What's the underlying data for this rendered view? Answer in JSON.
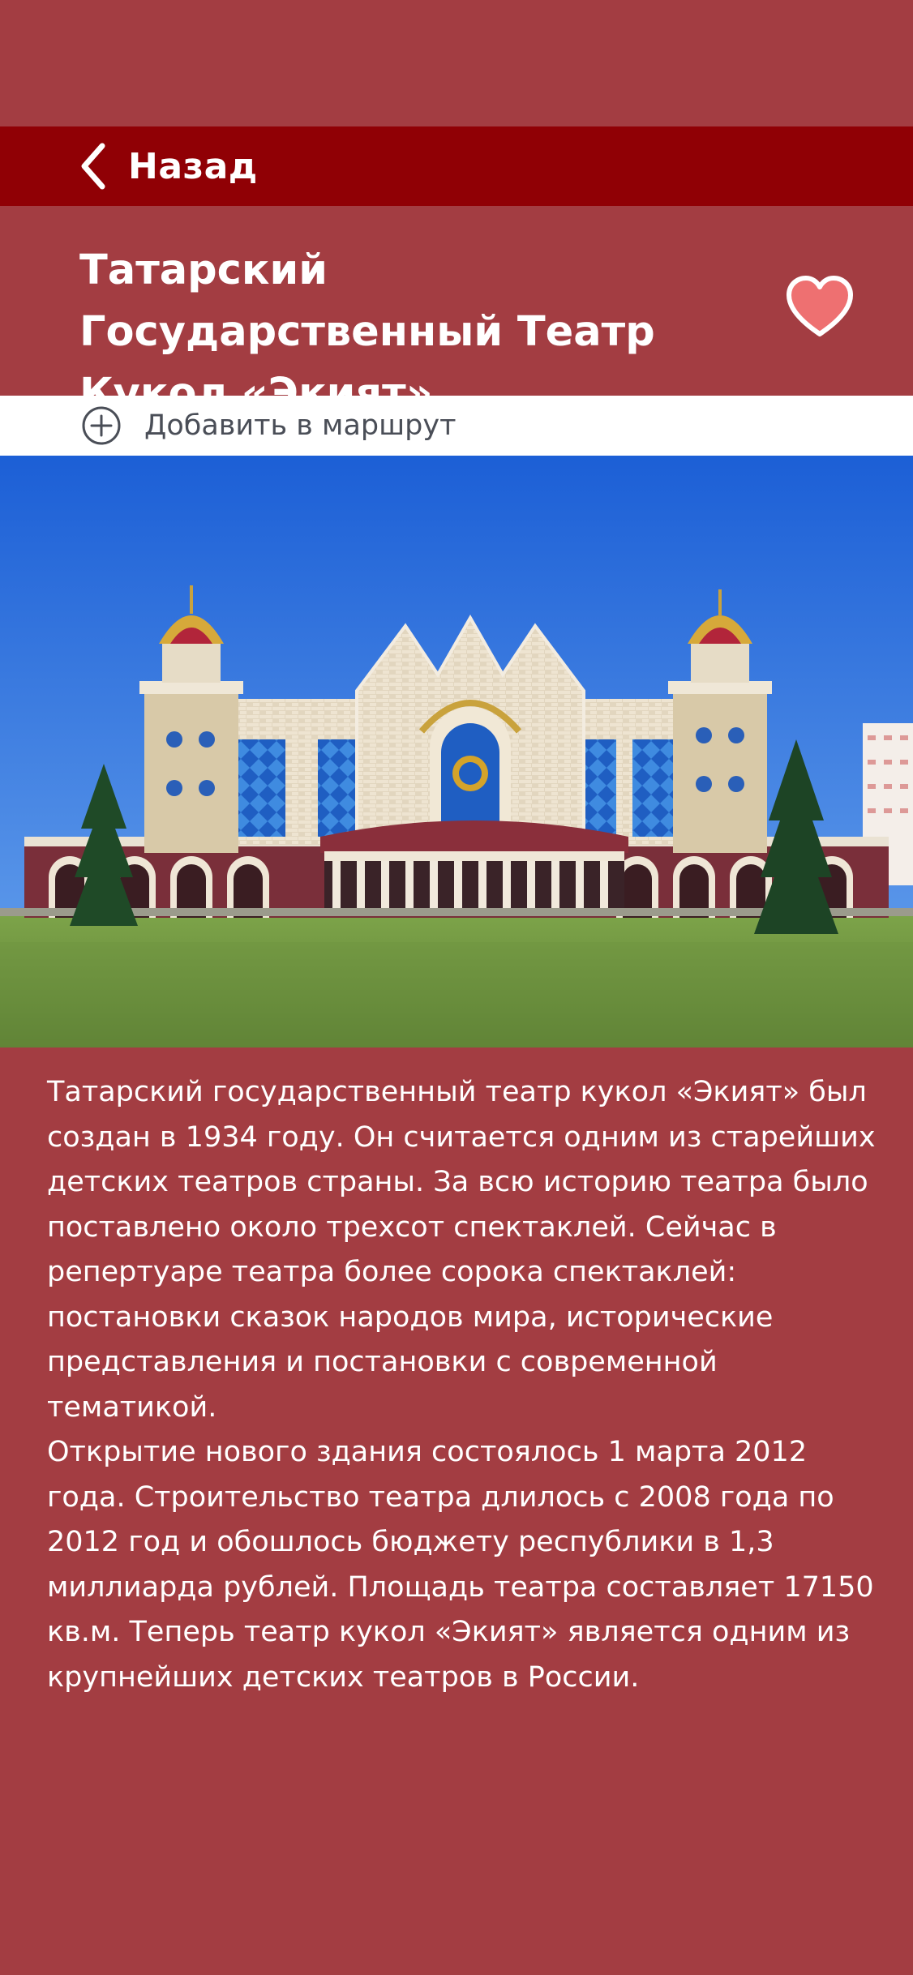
{
  "nav": {
    "back_label": "Назад"
  },
  "place": {
    "title": "Татарский Государственный Театр Кукол «Экият»",
    "favorite": true
  },
  "route": {
    "add_label": "Добавить в маршрут"
  },
  "colors": {
    "background": "#A33D42",
    "navbar": "#900005",
    "heart": "#EE7071",
    "route_text": "#4a4e57"
  },
  "description": {
    "paragraph1": "Татарский государственный театр кукол «Экият» был создан в 1934 году. Он считается одним из старейших детских театров страны. За всю историю театра было поставлено около трехсот спектаклей. Сейчас в репертуаре театра более сорока спектаклей: постановки сказок народов мира, исторические представления и постановки с современной тематикой.",
    "paragraph2": "Открытие нового здания состоялось 1 марта 2012 года. Строительство театра длилось с 2008 года по 2012 год и обошлось бюджету республики в 1,3 миллиарда рублей. Площадь театра составляет 17150 кв.м. Теперь театр кукол «Экият» является одним из крупнейших детских театров в России."
  }
}
